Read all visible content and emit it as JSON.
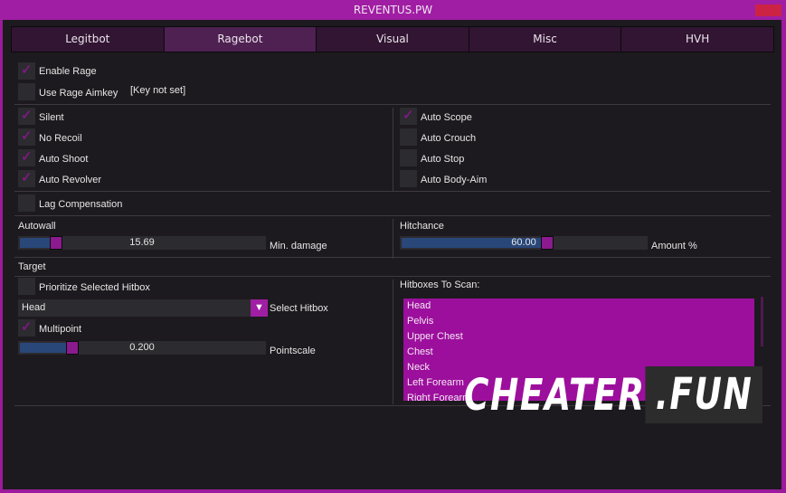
{
  "window": {
    "title": "REVENTUS.PW",
    "close_color": "#cc2244",
    "accent": "#a01ea3"
  },
  "tabs": [
    {
      "label": "Legitbot",
      "active": false
    },
    {
      "label": "Ragebot",
      "active": true
    },
    {
      "label": "Visual",
      "active": false
    },
    {
      "label": "Misc",
      "active": false
    },
    {
      "label": "HVH",
      "active": false
    }
  ],
  "general": {
    "enable_rage": {
      "label": "Enable Rage",
      "checked": true
    },
    "use_rage_aimkey": {
      "label": "Use Rage Aimkey",
      "checked": false,
      "key": "[Key not set]"
    }
  },
  "left_options": [
    {
      "label": "Silent",
      "checked": true
    },
    {
      "label": "No Recoil",
      "checked": true
    },
    {
      "label": "Auto Shoot",
      "checked": true
    },
    {
      "label": "Auto Revolver",
      "checked": true
    }
  ],
  "right_options": [
    {
      "label": "Auto Scope",
      "checked": true
    },
    {
      "label": "Auto Crouch",
      "checked": false
    },
    {
      "label": "Auto Stop",
      "checked": false
    },
    {
      "label": "Auto Body-Aim",
      "checked": false
    }
  ],
  "lag_compensation": {
    "label": "Lag Compensation",
    "checked": false
  },
  "autowall": {
    "section": "Autowall",
    "value": "15.69",
    "fraction": 0.13,
    "label": "Min. damage"
  },
  "hitchance": {
    "section": "Hitchance",
    "value": "60.00",
    "fraction": 0.6,
    "label": "Amount %"
  },
  "target": {
    "section": "Target",
    "prioritize": {
      "label": "Prioritize Selected Hitbox",
      "checked": false
    },
    "select_hitbox": {
      "value": "Head",
      "label": "Select Hitbox"
    },
    "multipoint": {
      "label": "Multipoint",
      "checked": true
    },
    "pointscale": {
      "value": "0.200",
      "fraction": 0.2,
      "label": "Pointscale"
    }
  },
  "hitboxes": {
    "label": "Hitboxes To Scan:",
    "items": [
      "Head",
      "Pelvis",
      "Upper Chest",
      "Chest",
      "Neck",
      "Left Forearm",
      "Right Forearm"
    ]
  },
  "watermark": {
    "main": "CHEATER",
    "suffix": ".FUN"
  }
}
